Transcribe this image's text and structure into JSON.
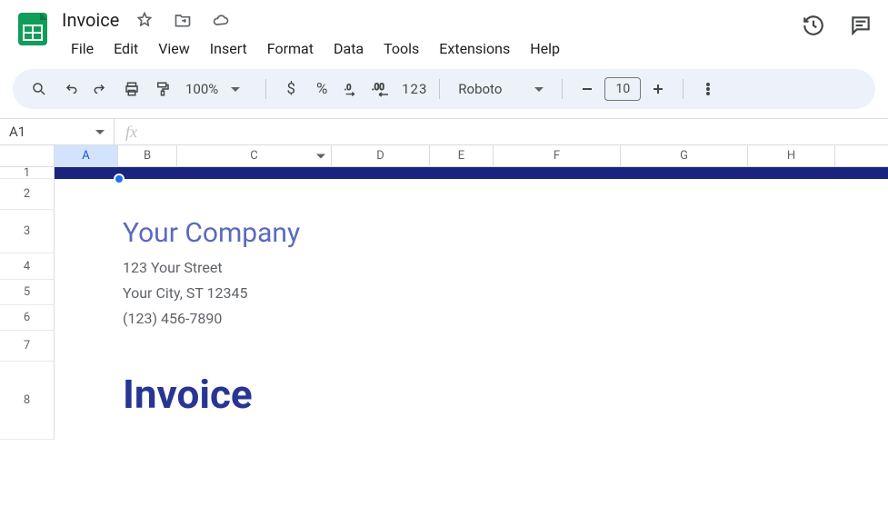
{
  "doc": {
    "title": "Invoice"
  },
  "menus": [
    "File",
    "Edit",
    "View",
    "Insert",
    "Format",
    "Data",
    "Tools",
    "Extensions",
    "Help"
  ],
  "toolbar": {
    "zoom": "100%",
    "currency": "$",
    "percent": "%",
    "num_fmt": "123",
    "font": "Roboto",
    "font_size": "10"
  },
  "namebox": {
    "cell": "A1"
  },
  "columns": [
    {
      "label": "A",
      "width": 70,
      "selected": true
    },
    {
      "label": "B",
      "width": 65
    },
    {
      "label": "C",
      "width": 170,
      "dropdown": true
    },
    {
      "label": "D",
      "width": 108
    },
    {
      "label": "E",
      "width": 70
    },
    {
      "label": "F",
      "width": 140
    },
    {
      "label": "G",
      "width": 140
    },
    {
      "label": "H",
      "width": 96
    }
  ],
  "rows": [
    {
      "label": "1",
      "height": 13
    },
    {
      "label": "2",
      "height": 34
    },
    {
      "label": "3",
      "height": 48
    },
    {
      "label": "4",
      "height": 29
    },
    {
      "label": "5",
      "height": 28
    },
    {
      "label": "6",
      "height": 28
    },
    {
      "label": "7",
      "height": 34
    },
    {
      "label": "8",
      "height": 86
    }
  ],
  "content": {
    "company": "Your Company",
    "street": "123 Your Street",
    "city": "Your City, ST 12345",
    "phone": "(123) 456-7890",
    "invoice_heading": "Invoice"
  }
}
